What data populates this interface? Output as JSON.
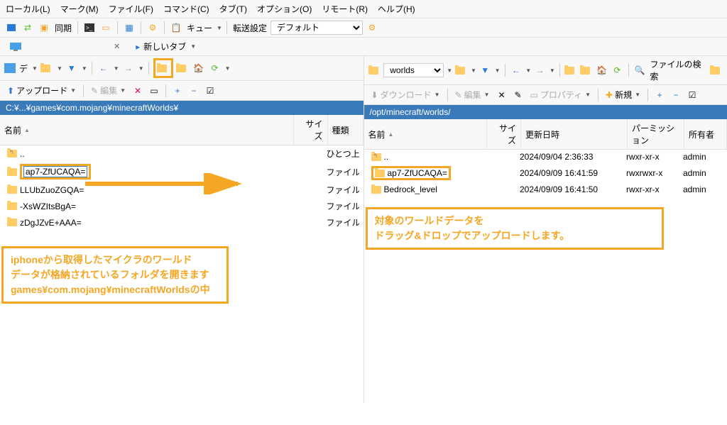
{
  "menu": [
    "ローカル(L)",
    "マーク(M)",
    "ファイル(F)",
    "コマンド(C)",
    "タブ(T)",
    "オプション(O)",
    "リモート(R)",
    "ヘルプ(H)"
  ],
  "topbar": {
    "sync": "同期",
    "queue": "キュー",
    "transfer_label": "転送設定",
    "transfer_value": "デフォルト"
  },
  "tabs": {
    "current_blank": "",
    "new_tab": "新しいタブ"
  },
  "left": {
    "drive": "デ",
    "path": "C:¥...¥games¥com.mojang¥minecraftWorlds¥",
    "upload": "アップロード",
    "edit": "編集",
    "cols": {
      "name": "名前",
      "size": "サイズ",
      "type": "種類"
    },
    "rows": [
      {
        "name": "..",
        "type": "ひとつ上",
        "up": true
      },
      {
        "name": "ap7-ZfUCAQA=",
        "type": "ファイル",
        "editing": true
      },
      {
        "name": "LLUbZuoZGQA=",
        "type": "ファイル"
      },
      {
        "name": "-XsWZItsBgA=",
        "type": "ファイル"
      },
      {
        "name": "zDgJZvE+AAA=",
        "type": "ファイル"
      }
    ],
    "annotation": "iphoneから取得したマイクラのワールド\nデータが格納されているフォルダを開きます\ngames¥com.mojang¥minecraftWorldsの中"
  },
  "right": {
    "folder": "worlds",
    "path": "/opt/minecraft/worlds/",
    "download": "ダウンロード",
    "edit": "編集",
    "props": "プロパティ",
    "new": "新規",
    "find": "ファイルの検索",
    "cols": {
      "name": "名前",
      "size": "サイズ",
      "date": "更新日時",
      "perm": "パーミッション",
      "owner": "所有者"
    },
    "rows": [
      {
        "name": "..",
        "date": "2024/09/04 2:36:33",
        "perm": "rwxr-xr-x",
        "owner": "admin",
        "up": true
      },
      {
        "name": "ap7-ZfUCAQA=",
        "date": "2024/09/09 16:41:59",
        "perm": "rwxrwxr-x",
        "owner": "admin",
        "selected": true
      },
      {
        "name": "Bedrock_level",
        "date": "2024/09/09 16:41:50",
        "perm": "rwxr-xr-x",
        "owner": "admin"
      }
    ],
    "annotation": "対象のワールドデータを\nドラッグ&ドロップでアップロードします。"
  }
}
